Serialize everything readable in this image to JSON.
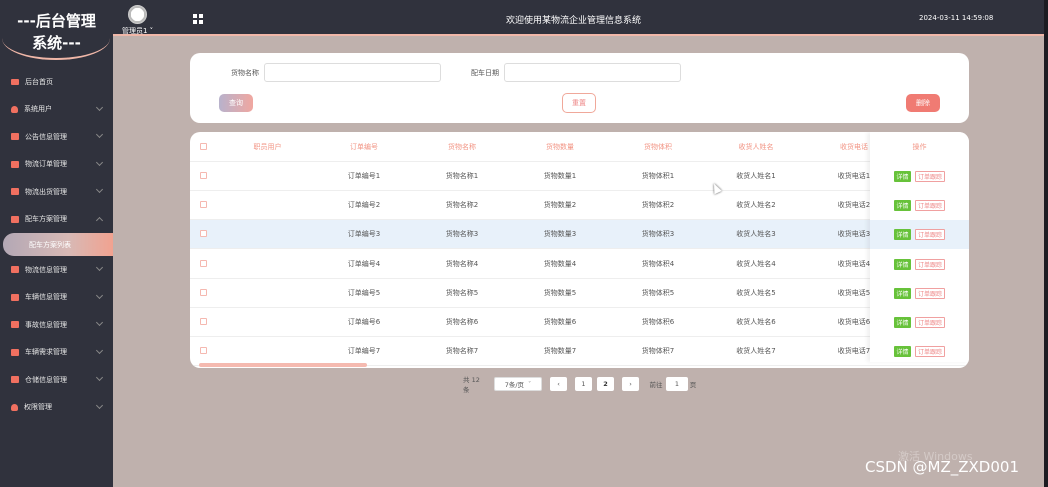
{
  "app": {
    "logo_line1": "---后台管理",
    "logo_line2": "系统---",
    "header_title": "欢迎使用某物流企业管理信息系统",
    "datetime": "2024-03-11 14:59:08",
    "user": "管理员1 ˅"
  },
  "sidebar": {
    "items": [
      {
        "label": "后台首页",
        "icon": "monitor-icon",
        "chevron": false
      },
      {
        "label": "系统用户",
        "icon": "user-icon",
        "chevron": true
      },
      {
        "label": "公告信息管理",
        "icon": "checkbox-icon",
        "chevron": true
      },
      {
        "label": "物流订单管理",
        "icon": "checkbox-icon",
        "chevron": true
      },
      {
        "label": "物流出货管理",
        "icon": "checkbox-icon",
        "chevron": true
      },
      {
        "label": "配车方案管理",
        "icon": "checkbox-icon",
        "chevron": true,
        "expanded": true
      },
      {
        "label": "物流信息管理",
        "icon": "checkbox-icon",
        "chevron": true
      },
      {
        "label": "车辆信息管理",
        "icon": "checkbox-icon",
        "chevron": true
      },
      {
        "label": "事故信息管理",
        "icon": "checkbox-icon",
        "chevron": true
      },
      {
        "label": "车辆需求管理",
        "icon": "checkbox-icon",
        "chevron": true
      },
      {
        "label": "仓储信息管理",
        "icon": "checkbox-icon",
        "chevron": true
      },
      {
        "label": "权限管理",
        "icon": "user-icon",
        "chevron": true
      }
    ],
    "active_subitem": "配车方案列表"
  },
  "search": {
    "field1_label": "货物名称",
    "field1_value": "",
    "field2_label": "配车日期",
    "field2_value": "",
    "query_label": "查询",
    "reset_label": "重置",
    "delete_label": "删除"
  },
  "table": {
    "headers": [
      "职员用户",
      "订单编号",
      "货物名称",
      "货物数量",
      "货物体积",
      "收货人姓名",
      "收货电话",
      "操作"
    ],
    "rows": [
      [
        "",
        "订单编号1",
        "货物名称1",
        "货物数量1",
        "货物体积1",
        "收货人姓名1",
        "收货电话1"
      ],
      [
        "",
        "订单编号2",
        "货物名称2",
        "货物数量2",
        "货物体积2",
        "收货人姓名2",
        "收货电话2"
      ],
      [
        "",
        "订单编号3",
        "货物名称3",
        "货物数量3",
        "货物体积3",
        "收货人姓名3",
        "收货电话3"
      ],
      [
        "",
        "订单编号4",
        "货物名称4",
        "货物数量4",
        "货物体积4",
        "收货人姓名4",
        "收货电话4"
      ],
      [
        "",
        "订单编号5",
        "货物名称5",
        "货物数量5",
        "货物体积5",
        "收货人姓名5",
        "收货电话5"
      ],
      [
        "",
        "订单编号6",
        "货物名称6",
        "货物数量6",
        "货物体积6",
        "收货人姓名6",
        "收货电话6"
      ],
      [
        "",
        "订单编号7",
        "货物名称7",
        "货物数量7",
        "货物体积7",
        "收货人姓名7",
        "收货电话7"
      ]
    ],
    "highlighted_row": 2,
    "detail_label": "详情",
    "track_label": "订单跟踪"
  },
  "pagination": {
    "total": "共 12 条",
    "page_size": "7条/页",
    "prev": "‹",
    "pages": [
      "1",
      "2"
    ],
    "current_page": "2",
    "next": "›",
    "goto_label": "前往",
    "goto_value": "1",
    "goto_suffix": "页"
  },
  "watermark": {
    "windows": "激活 Windows",
    "csdn": "CSDN @MZ_ZXD001"
  },
  "colors": {
    "sidebar_bg": "#30323d",
    "page_bg": "#bfb1ad",
    "accent": "#f29484",
    "delete": "#f07b73",
    "detail": "#67c23a"
  }
}
